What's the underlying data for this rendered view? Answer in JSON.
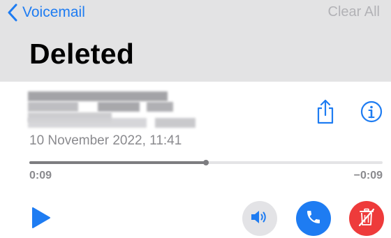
{
  "nav": {
    "back_label": "Voicemail",
    "clear_all_label": "Clear All"
  },
  "page": {
    "title": "Deleted"
  },
  "voicemail": {
    "caller": "(caller details blurred)",
    "date": "10 November 2022, 11:41",
    "elapsed": "0:09",
    "remaining": "−0:09",
    "progress": 0.5
  },
  "colors": {
    "accent": "#1e7cf2",
    "header_bg": "#e3e3e4",
    "disabled_text": "#b2b2b6",
    "secondary_text": "#8a8a8e",
    "speaker_bg": "#e3e3e6",
    "call_button": "#1e7cf2",
    "delete_button": "#ee3b3b"
  },
  "icons": {
    "back": "chevron-left-icon",
    "share": "share-icon",
    "info": "info-icon",
    "play": "play-icon",
    "speaker": "speaker-icon",
    "call": "phone-icon",
    "delete": "trash-icon"
  }
}
